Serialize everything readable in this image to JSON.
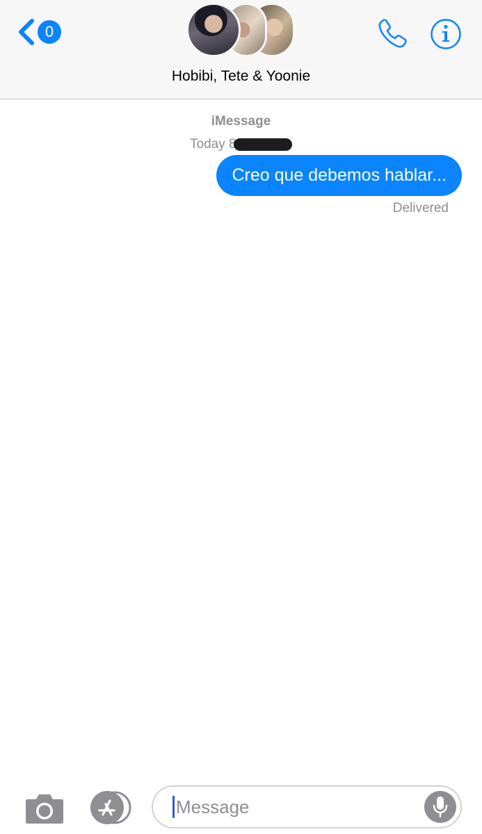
{
  "header": {
    "back_badge_count": "0",
    "conversation_title": "Hobibi, Tete & Yoonie",
    "avatars": [
      "avatar-hobibi",
      "avatar-tete",
      "avatar-yoonie"
    ],
    "icons": [
      "chevron-left-icon",
      "phone-icon",
      "info-icon"
    ]
  },
  "conversation": {
    "service_label": "iMessage",
    "timestamp_visible": "Today 8",
    "messages": [
      {
        "direction": "outgoing",
        "text": "Creo que debemos hablar...",
        "status": "Delivered"
      }
    ]
  },
  "composer": {
    "placeholder": "Message",
    "icons": [
      "camera-icon",
      "app-store-icon",
      "microphone-icon"
    ]
  },
  "colors": {
    "accent": "#0a84ff",
    "secondary_text": "#8e8e93",
    "header_background": "#f7f7f7",
    "bubble_text": "#ffffff"
  }
}
